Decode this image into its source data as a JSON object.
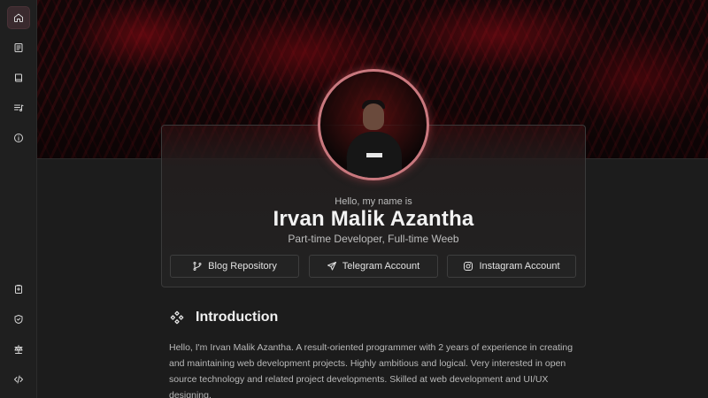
{
  "sidebar": {
    "top_items": [
      {
        "icon": "home-icon",
        "active": true
      },
      {
        "icon": "news-icon",
        "active": false
      },
      {
        "icon": "book-icon",
        "active": false
      },
      {
        "icon": "playlist-icon",
        "active": false
      },
      {
        "icon": "info-icon",
        "active": false
      }
    ],
    "bottom_items": [
      {
        "icon": "clipboard-icon"
      },
      {
        "icon": "shield-icon"
      },
      {
        "icon": "scale-icon"
      },
      {
        "icon": "code-icon"
      }
    ]
  },
  "profile": {
    "greeting": "Hello, my name is",
    "name": "Irvan Malik Azantha",
    "tagline": "Part-time Developer, Full-time Weeb",
    "links": [
      {
        "label": "Blog Repository",
        "icon": "git-branch-icon"
      },
      {
        "label": "Telegram Account",
        "icon": "send-icon"
      },
      {
        "label": "Instagram Account",
        "icon": "instagram-icon"
      }
    ]
  },
  "intro": {
    "title": "Introduction",
    "icon": "diamond-grid-icon",
    "text": "Hello, I'm Irvan Malik Azantha. A result-oriented programmer with 2 years of experience in creating and maintaining web development projects. Highly ambitious and logical. Very interested in open source technology and related project developments. Skilled at web development and UI/UX designing."
  },
  "colors": {
    "accent": "#c9787e",
    "background": "#1c1c1c",
    "banner": "#8c0a14"
  }
}
